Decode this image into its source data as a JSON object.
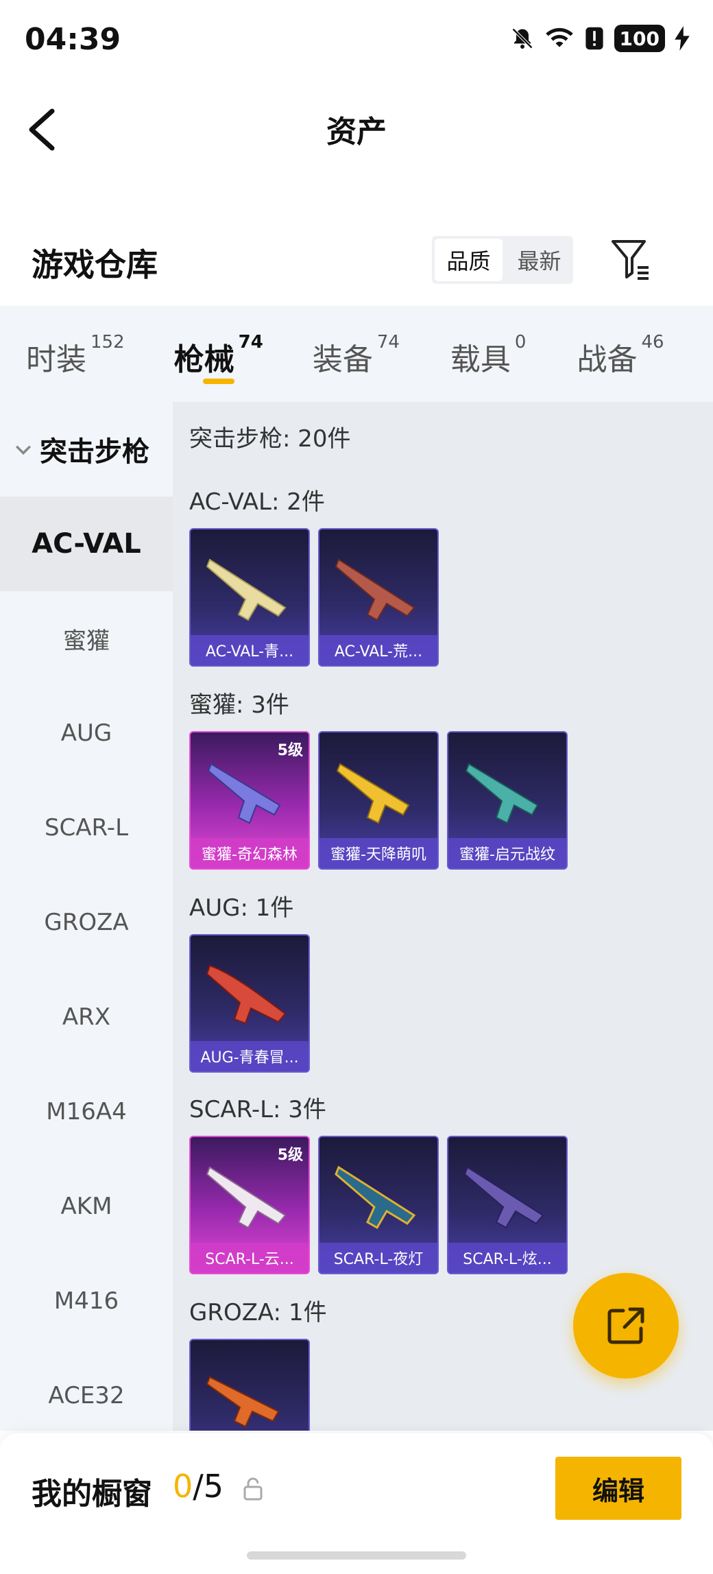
{
  "status": {
    "time": "04:39",
    "battery": "100"
  },
  "header": {
    "title": "资产"
  },
  "warehouse": {
    "title": "游戏仓库",
    "sort_options": [
      "品质",
      "最新"
    ],
    "sort_selected": "品质"
  },
  "tabs": [
    {
      "label": "时装",
      "count": "152"
    },
    {
      "label": "枪械",
      "count": "74"
    },
    {
      "label": "装备",
      "count": "74"
    },
    {
      "label": "载具",
      "count": "0"
    },
    {
      "label": "战备",
      "count": "46"
    }
  ],
  "active_tab": "枪械",
  "sidebar": {
    "group": "突击步枪",
    "items": [
      "AC-VAL",
      "蜜獾",
      "AUG",
      "SCAR-L",
      "GROZA",
      "ARX",
      "M16A4",
      "AKM",
      "M416",
      "ACE32"
    ],
    "active": "AC-VAL"
  },
  "main": {
    "section_title": "突击步枪: 20件",
    "groups": [
      {
        "title": "AC-VAL: 2件",
        "items": [
          {
            "label": "AC-VAL-青...",
            "rarity": "blue",
            "level": ""
          },
          {
            "label": "AC-VAL-荒...",
            "rarity": "blue",
            "level": ""
          }
        ]
      },
      {
        "title": "蜜獾: 3件",
        "items": [
          {
            "label": "蜜獾-奇幻森林",
            "rarity": "pink",
            "level": "5级"
          },
          {
            "label": "蜜獾-天降萌叽",
            "rarity": "blue",
            "level": ""
          },
          {
            "label": "蜜獾-启元战纹",
            "rarity": "blue",
            "level": ""
          }
        ]
      },
      {
        "title": "AUG: 1件",
        "items": [
          {
            "label": "AUG-青春冒...",
            "rarity": "blue",
            "level": ""
          }
        ]
      },
      {
        "title": "SCAR-L: 3件",
        "items": [
          {
            "label": "SCAR-L-云...",
            "rarity": "pink",
            "level": "5级"
          },
          {
            "label": "SCAR-L-夜灯",
            "rarity": "blue",
            "level": ""
          },
          {
            "label": "SCAR-L-炫...",
            "rarity": "blue",
            "level": ""
          }
        ]
      },
      {
        "title": "GROZA: 1件",
        "items": [
          {
            "label": "",
            "rarity": "blue",
            "level": ""
          }
        ]
      }
    ]
  },
  "bottom": {
    "showcase_label": "我的橱窗",
    "count_current": "0",
    "count_sep": "/5",
    "edit_label": "编辑"
  },
  "colors": {
    "accent": "#f5b400",
    "rare_blue": "#4a3fa8",
    "rare_pink": "#e04ad0"
  }
}
